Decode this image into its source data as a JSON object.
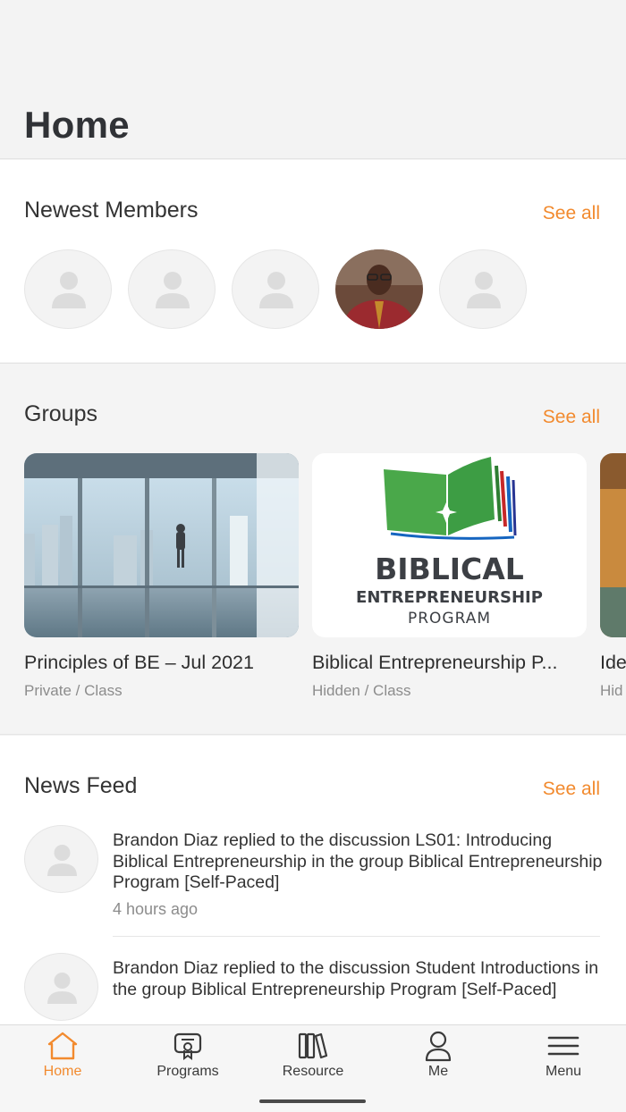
{
  "page": {
    "title": "Home"
  },
  "members": {
    "title": "Newest Members",
    "see_all": "See all",
    "avatars": [
      "placeholder",
      "placeholder",
      "placeholder",
      "photo",
      "placeholder"
    ]
  },
  "groups": {
    "title": "Groups",
    "see_all": "See all",
    "items": [
      {
        "name": "Principles of BE – Jul 2021",
        "meta": "Private / Class"
      },
      {
        "name": "Biblical Entrepreneurship P...",
        "meta": "Hidden / Class",
        "logo_line1": "BIBLICAL",
        "logo_line2": "ENTREPRENEURSHIP",
        "logo_line3": "PROGRAM"
      },
      {
        "name": "Ide",
        "meta": "Hid"
      }
    ]
  },
  "news": {
    "title": "News Feed",
    "see_all": "See all",
    "items": [
      {
        "text": "Brandon Diaz replied to the discussion LS01: Introducing Biblical Entrepreneurship in the group Biblical Entrepreneurship Program [Self-Paced]",
        "time": "4 hours ago"
      },
      {
        "text": "Brandon Diaz replied to the discussion Student Introductions in the group Biblical Entrepreneurship Program [Self-Paced]",
        "time": ""
      }
    ]
  },
  "tabs": [
    {
      "label": "Home",
      "icon": "home-icon",
      "active": true
    },
    {
      "label": "Programs",
      "icon": "certificate-icon",
      "active": false
    },
    {
      "label": "Resource",
      "icon": "books-icon",
      "active": false
    },
    {
      "label": "Me",
      "icon": "person-icon",
      "active": false
    },
    {
      "label": "Menu",
      "icon": "hamburger-icon",
      "active": false
    }
  ],
  "colors": {
    "accent": "#f28a2e",
    "text": "#2b2b2b",
    "muted": "#8c8c8c",
    "background": "#f3f3f3"
  }
}
